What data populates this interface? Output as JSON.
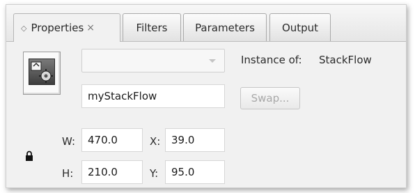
{
  "tabs": [
    {
      "label": "Properties",
      "active": true
    },
    {
      "label": "Filters",
      "active": false
    },
    {
      "label": "Parameters",
      "active": false
    },
    {
      "label": "Output",
      "active": false
    }
  ],
  "tab_sort_glyph": "◇",
  "tab_close_glyph": "×",
  "symbol": {
    "dropdown_value": ""
  },
  "instance_name": "myStackFlow",
  "instance_of_label": "Instance of:",
  "instance_of_value": "StackFlow",
  "swap_label": "Swap...",
  "geometry": {
    "w_label": "W:",
    "w_value": "470.0",
    "h_label": "H:",
    "h_value": "210.0",
    "x_label": "X:",
    "x_value": "39.0",
    "y_label": "Y:",
    "y_value": "95.0"
  },
  "icons": {
    "symbol": "component-icon",
    "lock": "lock-icon",
    "dropdown": "chevron-down-icon"
  },
  "colors": {
    "panel_bg": "#f1f1f1",
    "field_bg": "#ffffff",
    "disabled_text": "#a8a8a8"
  }
}
